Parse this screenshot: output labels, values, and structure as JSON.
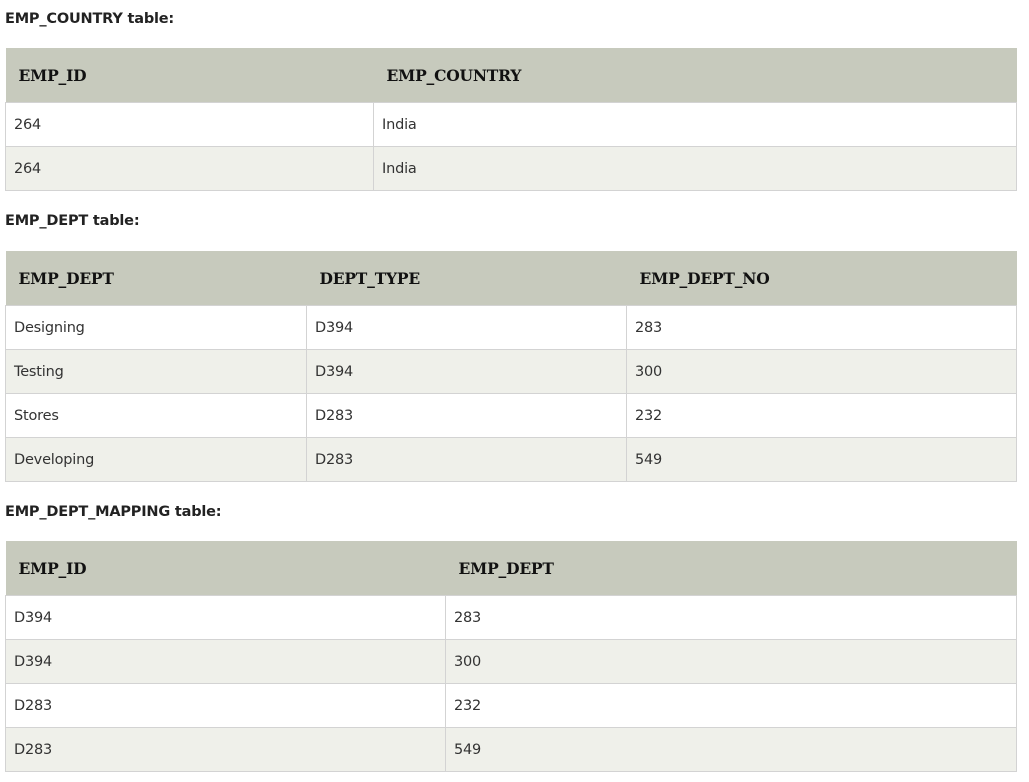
{
  "sections": [
    {
      "title": "EMP_COUNTRY table:",
      "headers": [
        "EMP_ID",
        "EMP_COUNTRY"
      ],
      "rows": [
        [
          "264",
          "India"
        ],
        [
          "264",
          "India"
        ]
      ]
    },
    {
      "title": "EMP_DEPT table:",
      "headers": [
        "EMP_DEPT",
        "DEPT_TYPE",
        "EMP_DEPT_NO"
      ],
      "rows": [
        [
          "Designing",
          "D394",
          "283"
        ],
        [
          "Testing",
          "D394",
          "300"
        ],
        [
          "Stores",
          "D283",
          "232"
        ],
        [
          "Developing",
          "D283",
          "549"
        ]
      ]
    },
    {
      "title": "EMP_DEPT_MAPPING table:",
      "headers": [
        "EMP_ID",
        "EMP_DEPT"
      ],
      "rows": [
        [
          "D394",
          "283"
        ],
        [
          "D394",
          "300"
        ],
        [
          "D283",
          "232"
        ],
        [
          "D283",
          "549"
        ]
      ]
    }
  ]
}
